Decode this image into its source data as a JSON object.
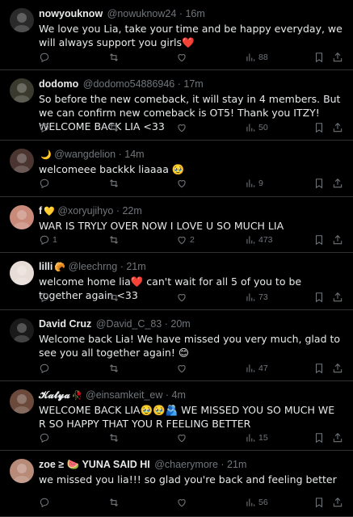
{
  "tweets": [
    {
      "name": "nowyouknow",
      "badge": "",
      "handle": "@nowuknow24",
      "time": "16m",
      "text": "We love you Lia, take your time and be happy everyday, we will always support you girls❤️",
      "replies": "",
      "retweets": "",
      "likes": "",
      "views": "88",
      "avatar_color": "#2a2a2a"
    },
    {
      "name": "dodomo",
      "badge": "",
      "handle": "@dodomo54886946",
      "time": "17m",
      "text": "So before the new comeback, it will stay in 4 members. But we can confirm new comeback is OT5! Thank you ITZY! WELCOME BACK LIA <33",
      "replies": "",
      "retweets": "",
      "likes": "",
      "views": "50",
      "avatar_color": "#3a3a2e"
    },
    {
      "name": "",
      "badge": "🌙",
      "handle": "@wangdelion",
      "time": "14m",
      "text": "welcomeee backkk liaaaa 🥹",
      "replies": "",
      "retweets": "",
      "likes": "",
      "views": "9",
      "avatar_color": "#4a3530"
    },
    {
      "name": "f",
      "badge": "💛",
      "handle": "@xoryujihyo",
      "time": "22m",
      "text": "WAR IS TRYLY OVER NOW I LOVE U SO MUCH LIA",
      "replies": "1",
      "retweets": "",
      "likes": "2",
      "views": "473",
      "avatar_color": "#c98a7a"
    },
    {
      "name": "lilli",
      "badge": "🥐",
      "handle": "@leechrng",
      "time": "21m",
      "text": "welcome home lia❤️ can't wait for all 5 of you to be together again <33",
      "replies": "",
      "retweets": "",
      "likes": "",
      "views": "73",
      "avatar_color": "#e8dcd6"
    },
    {
      "name": "David Cruz",
      "badge": "",
      "handle": "@David_C_83",
      "time": "20m",
      "text": "Welcome back Lia! We have missed you very much, glad to see you all together again! 😊",
      "replies": "",
      "retweets": "",
      "likes": "",
      "views": "47",
      "avatar_color": "#1a1a1a"
    },
    {
      "name": "𝓚𝓪𝓽𝔂𝓪",
      "badge": "🥀",
      "handle": "@einsamkeit_ew",
      "time": "4m",
      "text": "WELCOME BACK LIA🥹🥹🫂 WE MISSED YOU SO MUCH WE R SO HAPPY THAT YOU R FEELING BETTER",
      "replies": "",
      "retweets": "",
      "likes": "",
      "views": "15",
      "avatar_color": "#6b4a3c"
    },
    {
      "name": "zoe ≥ 🍉 YUNA SAID HI",
      "badge": "",
      "handle": "@chaerymore",
      "time": "21m",
      "text": "we missed you lia!!! so glad you're back and feeling better",
      "replies": "",
      "retweets": "",
      "likes": "",
      "views": "56",
      "avatar_color": "#b88a78"
    }
  ]
}
